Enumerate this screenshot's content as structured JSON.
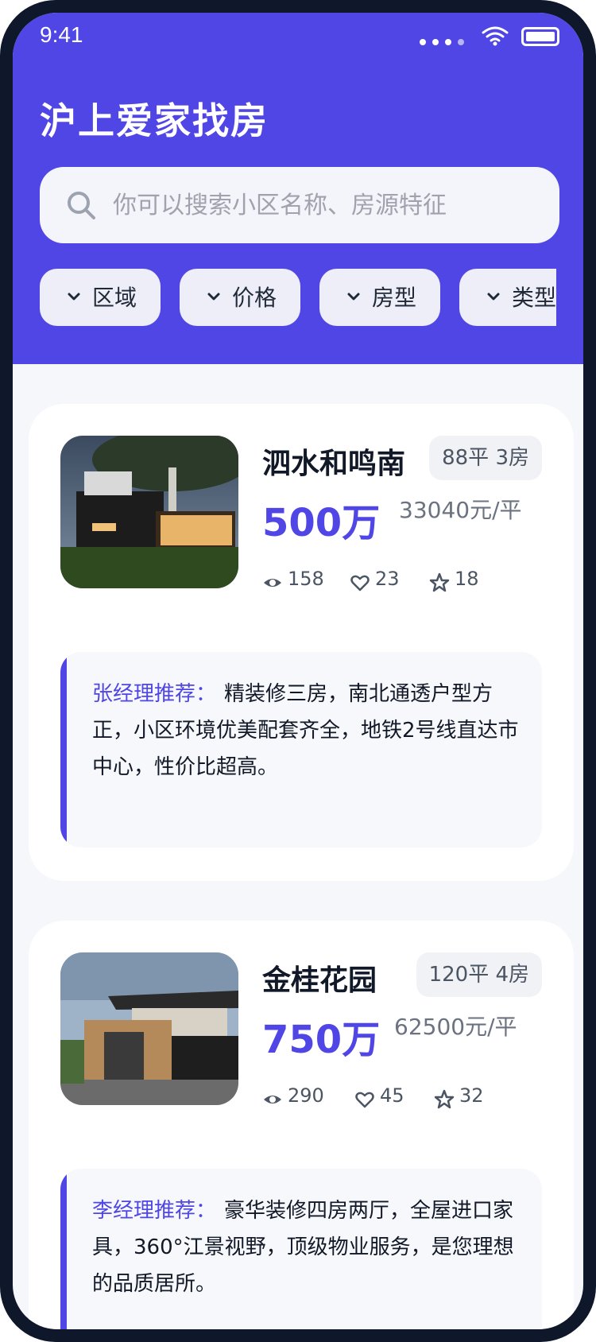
{
  "status": {
    "time": "9:41"
  },
  "header": {
    "title": "沪上爱家找房"
  },
  "search": {
    "placeholder": "你可以搜索小区名称、房源特征"
  },
  "filters": [
    {
      "label": "区域"
    },
    {
      "label": "价格"
    },
    {
      "label": "房型"
    },
    {
      "label": "类型"
    }
  ],
  "listings": [
    {
      "name": "泗水和鸣南",
      "spec": "88平 3房",
      "price": "500万",
      "unit_price": "33040元/平",
      "views": "158",
      "likes": "23",
      "favorites": "18",
      "recommender": "张经理推荐：",
      "recommendation": "精装修三房，南北通透户型方正，小区环境优美配套齐全，地铁2号线直达市中心，性价比超高。"
    },
    {
      "name": "金桂花园",
      "spec": "120平 4房",
      "price": "750万",
      "unit_price": "62500元/平",
      "views": "290",
      "likes": "45",
      "favorites": "32",
      "recommender": "李经理推荐：",
      "recommendation": "豪华装修四房两厅，全屋进口家具，360°江景视野，顶级物业服务，是您理想的品质居所。"
    }
  ],
  "colors": {
    "accent": "#4f46e5",
    "background": "#f6f7fb"
  }
}
